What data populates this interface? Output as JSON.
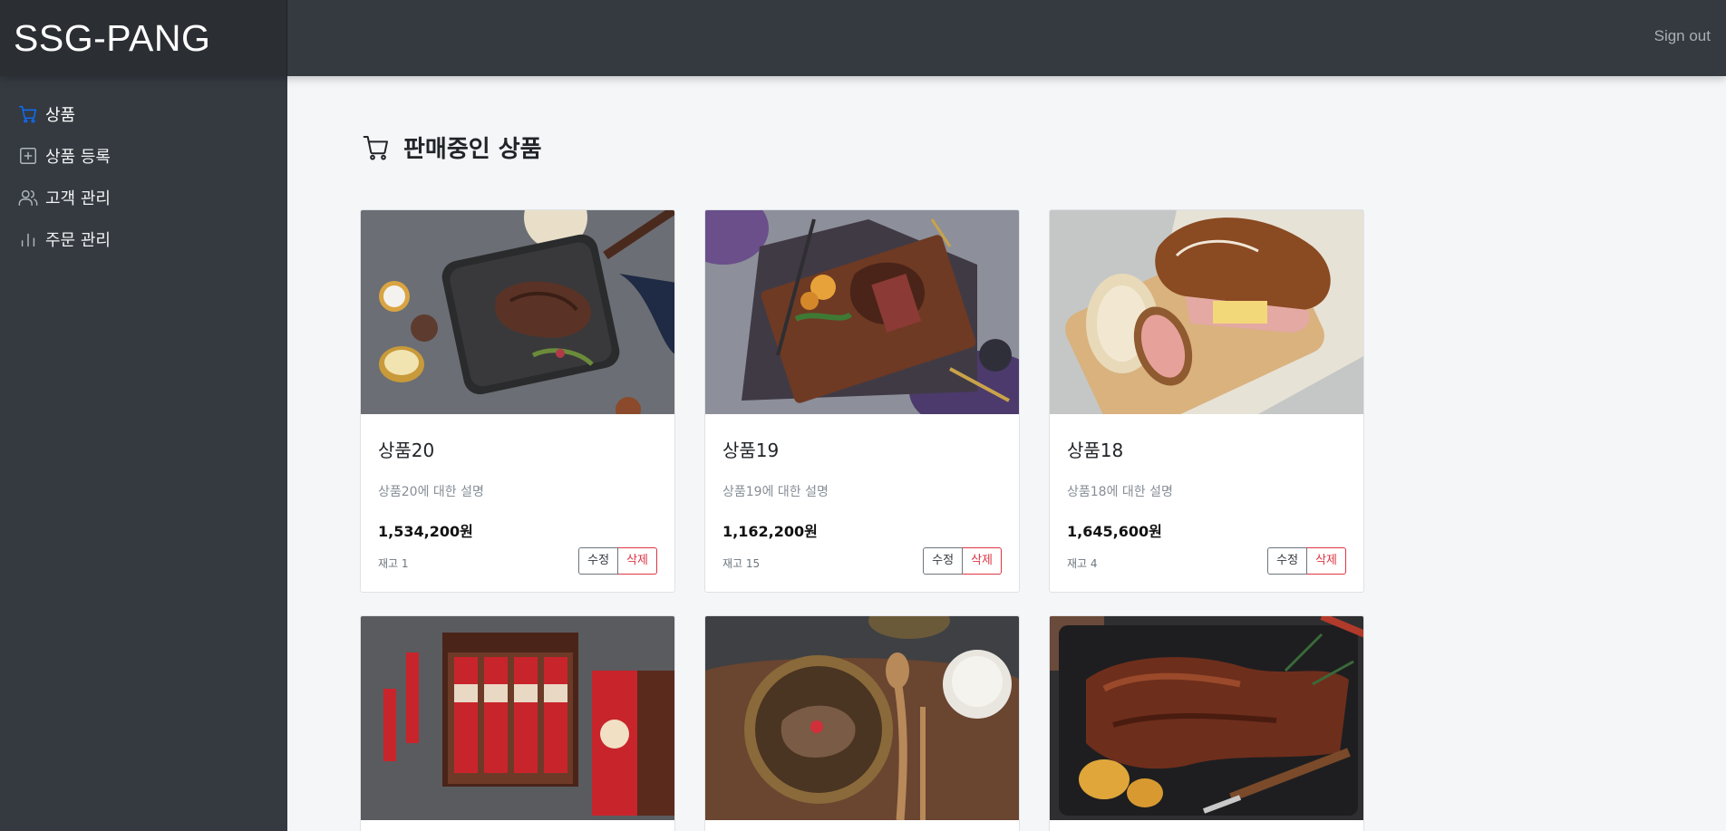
{
  "app": {
    "brand": "SSG-PANG",
    "sign_out": "Sign out"
  },
  "sidebar": {
    "items": [
      {
        "label": "상품",
        "icon": "cart-icon",
        "active": true
      },
      {
        "label": "상품 등록",
        "icon": "plus-square-icon",
        "active": false
      },
      {
        "label": "고객 관리",
        "icon": "users-icon",
        "active": false
      },
      {
        "label": "주문 관리",
        "icon": "bar-chart-icon",
        "active": false
      }
    ]
  },
  "main": {
    "title": "판매중인 상품",
    "title_icon": "cart-icon",
    "products": [
      {
        "name": "상품20",
        "desc": "상품20에 대한 설명",
        "price": "1,534,200원",
        "stock": "재고 1",
        "edit": "수정",
        "delete": "삭제",
        "image": "steak-in-pan"
      },
      {
        "name": "상품19",
        "desc": "상품19에 대한 설명",
        "price": "1,162,200원",
        "stock": "재고 15",
        "edit": "수정",
        "delete": "삭제",
        "image": "steak-on-board"
      },
      {
        "name": "상품18",
        "desc": "상품18에 대한 설명",
        "price": "1,645,600원",
        "stock": "재고 4",
        "edit": "수정",
        "delete": "삭제",
        "image": "ham-sandwich"
      },
      {
        "image": "red-ginseng-box"
      },
      {
        "image": "beef-soup"
      },
      {
        "image": "bbq-ribs"
      }
    ]
  },
  "colors": {
    "topbar": "#343a40",
    "brand_bg": "#2b2f34",
    "active_icon": "#0d6efd",
    "delete": "#dc3545",
    "page_bg": "#f5f6f8"
  }
}
